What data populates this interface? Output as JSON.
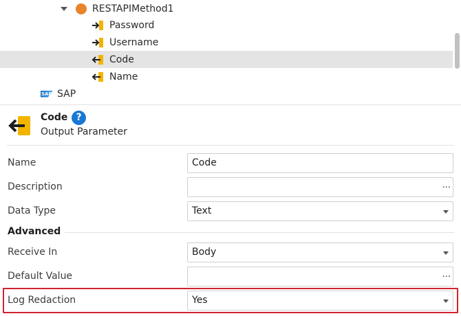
{
  "tree": {
    "items": [
      {
        "label": "RESTAPIMethod1",
        "kind": "method",
        "icon": "rest-method-icon"
      },
      {
        "label": "Password",
        "kind": "input",
        "icon": "input-parameter-icon"
      },
      {
        "label": "Username",
        "kind": "input",
        "icon": "input-parameter-icon"
      },
      {
        "label": "Code",
        "kind": "output",
        "icon": "output-parameter-icon"
      },
      {
        "label": "Name",
        "kind": "output",
        "icon": "output-parameter-icon"
      },
      {
        "label": "SAP",
        "kind": "sap",
        "icon": "sap-logo-icon"
      }
    ]
  },
  "header": {
    "title": "Code",
    "subtitle": "Output Parameter",
    "help": "?"
  },
  "properties": {
    "name": {
      "label": "Name",
      "value": "Code"
    },
    "description": {
      "label": "Description",
      "value": ""
    },
    "data_type": {
      "label": "Data Type",
      "value": "Text"
    },
    "advanced": "Advanced",
    "receive_in": {
      "label": "Receive In",
      "value": "Body"
    },
    "default_value": {
      "label": "Default Value",
      "value": ""
    },
    "log_redaction": {
      "label": "Log Redaction",
      "value": "Yes"
    }
  },
  "ui": {
    "ellipsis": "...",
    "sap_logo_text": "SAP"
  },
  "colors": {
    "accent_orange": "#e8842b",
    "pin_yellow": "#f2b400",
    "help_blue": "#1878d6",
    "highlight_red": "#d2222d",
    "selected_row": "#e4e4e4"
  }
}
